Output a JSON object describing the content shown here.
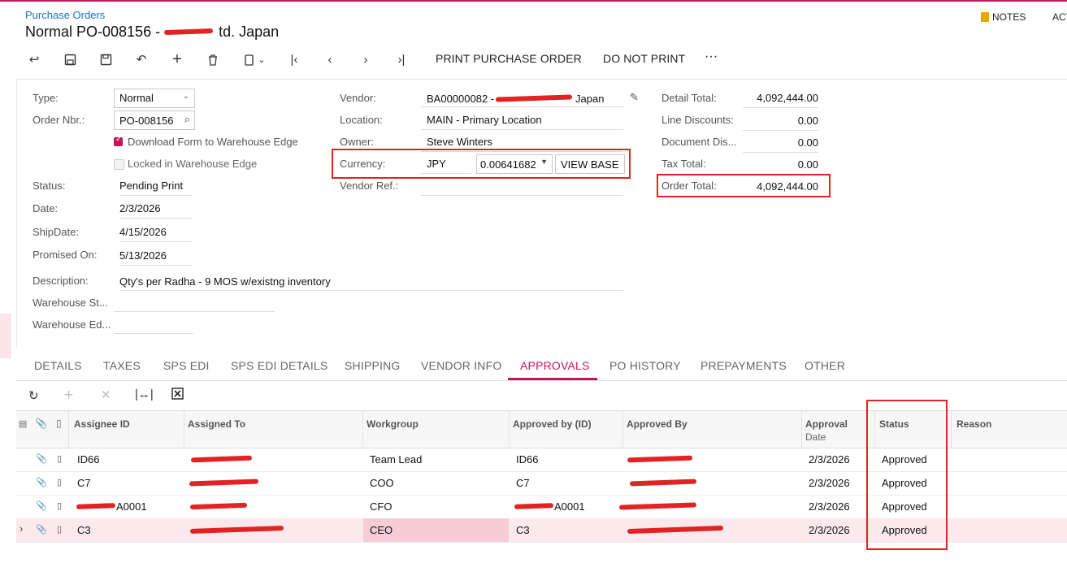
{
  "header": {
    "breadcrumb": "Purchase Orders",
    "title_prefix": "Normal PO-008156 -",
    "title_suffix": "td. Japan",
    "notes_label": "NOTES",
    "activities_label": "ACT"
  },
  "toolbar": {
    "print_po": "PRINT PURCHASE ORDER",
    "do_not_print": "DO NOT PRINT",
    "more": "···"
  },
  "form": {
    "type_label": "Type:",
    "type_value": "Normal",
    "order_nbr_label": "Order Nbr.:",
    "order_nbr_value": "PO-008156",
    "download_form_label": "Download Form to Warehouse Edge",
    "download_form_checked": true,
    "locked_label": "Locked in Warehouse Edge",
    "locked_checked": false,
    "status_label": "Status:",
    "status_value": "Pending Print",
    "date_label": "Date:",
    "date_value": "2/3/2026",
    "shipdate_label": "ShipDate:",
    "shipdate_value": "4/15/2026",
    "promised_label": "Promised On:",
    "promised_value": "5/13/2026",
    "description_label": "Description:",
    "description_value": "Qty's per Radha -  9 MOS w/existng inventory",
    "warehouse_st_label": "Warehouse St...",
    "warehouse_ed_label": "Warehouse Ed...",
    "vendor_label": "Vendor:",
    "vendor_value": "BA00000082 -",
    "vendor_value_tail": "Japan",
    "location_label": "Location:",
    "location_value": "MAIN - Primary Location",
    "owner_label": "Owner:",
    "owner_value": "Steve Winters",
    "currency_label": "Currency:",
    "currency_value": "JPY",
    "rate_value": "0.00641682",
    "view_base_label": "VIEW BASE",
    "vendor_ref_label": "Vendor Ref.:",
    "detail_total_label": "Detail Total:",
    "detail_total_value": "4,092,444.00",
    "line_discounts_label": "Line Discounts:",
    "line_discounts_value": "0.00",
    "document_dis_label": "Document Dis...",
    "document_dis_value": "0.00",
    "tax_total_label": "Tax Total:",
    "tax_total_value": "0.00",
    "order_total_label": "Order Total:",
    "order_total_value": "4,092,444.00"
  },
  "tabs": [
    "DETAILS",
    "TAXES",
    "SPS EDI",
    "SPS EDI DETAILS",
    "SHIPPING",
    "VENDOR INFO",
    "APPROVALS",
    "PO HISTORY",
    "PREPAYMENTS",
    "OTHER"
  ],
  "active_tab": "APPROVALS",
  "grid": {
    "columns": {
      "assignee_id": "Assignee ID",
      "assigned_to": "Assigned To",
      "workgroup": "Workgroup",
      "approved_by_id": "Approved by (ID)",
      "approved_by": "Approved By",
      "approval_date_1": "Approval",
      "approval_date_2": "Date",
      "status": "Status",
      "reason": "Reason"
    },
    "rows": [
      {
        "assignee_id": "ID66",
        "assigned_to": "",
        "workgroup": "Team Lead",
        "approved_by_id": "ID66",
        "approved_by": "",
        "approval_date": "2/3/2026",
        "status": "Approved"
      },
      {
        "assignee_id": "C7",
        "assigned_to": "",
        "workgroup": "COO",
        "approved_by_id": "C7",
        "approved_by": "",
        "approval_date": "2/3/2026",
        "status": "Approved"
      },
      {
        "assignee_id": "A0001",
        "assigned_to": "",
        "workgroup": "CFO",
        "approved_by_id": "A0001",
        "approved_by": "",
        "approval_date": "2/3/2026",
        "status": "Approved"
      },
      {
        "assignee_id": "C3",
        "assigned_to": "",
        "workgroup": "CEO",
        "approved_by_id": "C3",
        "approved_by": "",
        "approval_date": "2/3/2026",
        "status": "Approved"
      }
    ]
  },
  "colors": {
    "accent": "#c2185b",
    "annotation": "#e02424",
    "link": "#1a73b8"
  }
}
